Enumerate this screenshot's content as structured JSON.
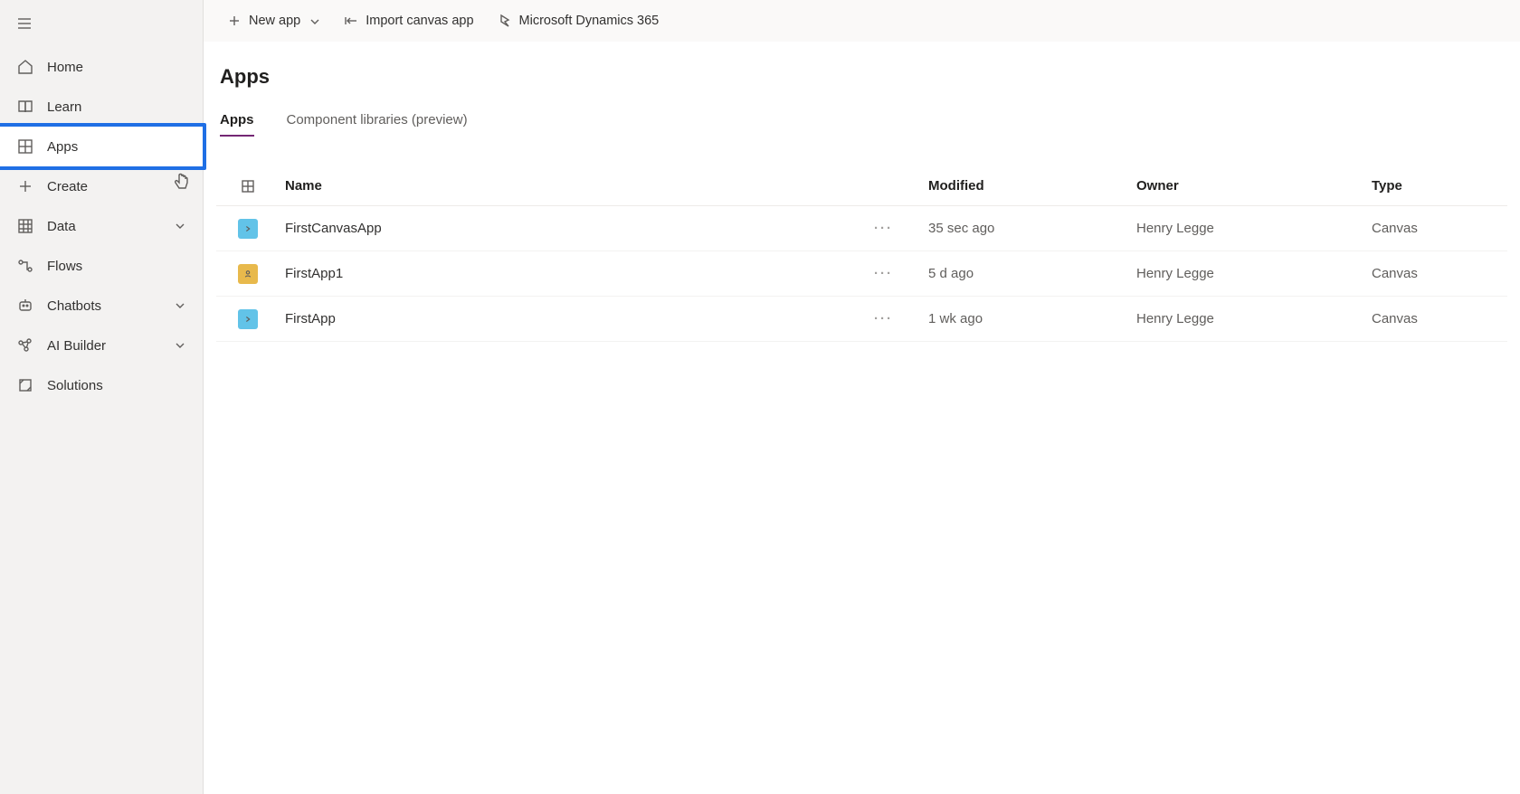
{
  "sidebar": {
    "items": [
      {
        "label": "Home",
        "icon": "home-icon"
      },
      {
        "label": "Learn",
        "icon": "book-icon"
      },
      {
        "label": "Apps",
        "icon": "apps-icon",
        "selected": true,
        "highlighted": true
      },
      {
        "label": "Create",
        "icon": "plus-icon"
      },
      {
        "label": "Data",
        "icon": "grid-icon",
        "expandable": true
      },
      {
        "label": "Flows",
        "icon": "flow-icon"
      },
      {
        "label": "Chatbots",
        "icon": "bot-icon",
        "expandable": true
      },
      {
        "label": "AI Builder",
        "icon": "ai-icon",
        "expandable": true
      },
      {
        "label": "Solutions",
        "icon": "solutions-icon"
      }
    ]
  },
  "cmdbar": {
    "new_app": "New app",
    "import": "Import canvas app",
    "dynamics": "Microsoft Dynamics 365"
  },
  "page": {
    "title": "Apps"
  },
  "tabs": [
    {
      "label": "Apps",
      "active": true
    },
    {
      "label": "Component libraries (preview)",
      "active": false
    }
  ],
  "table": {
    "headers": {
      "name": "Name",
      "modified": "Modified",
      "owner": "Owner",
      "type": "Type"
    },
    "rows": [
      {
        "name": "FirstCanvasApp",
        "modified": "35 sec ago",
        "owner": "Henry Legge",
        "type": "Canvas",
        "iconColor": "blue"
      },
      {
        "name": "FirstApp1",
        "modified": "5 d ago",
        "owner": "Henry Legge",
        "type": "Canvas",
        "iconColor": "yellow"
      },
      {
        "name": "FirstApp",
        "modified": "1 wk ago",
        "owner": "Henry Legge",
        "type": "Canvas",
        "iconColor": "blue"
      }
    ]
  }
}
